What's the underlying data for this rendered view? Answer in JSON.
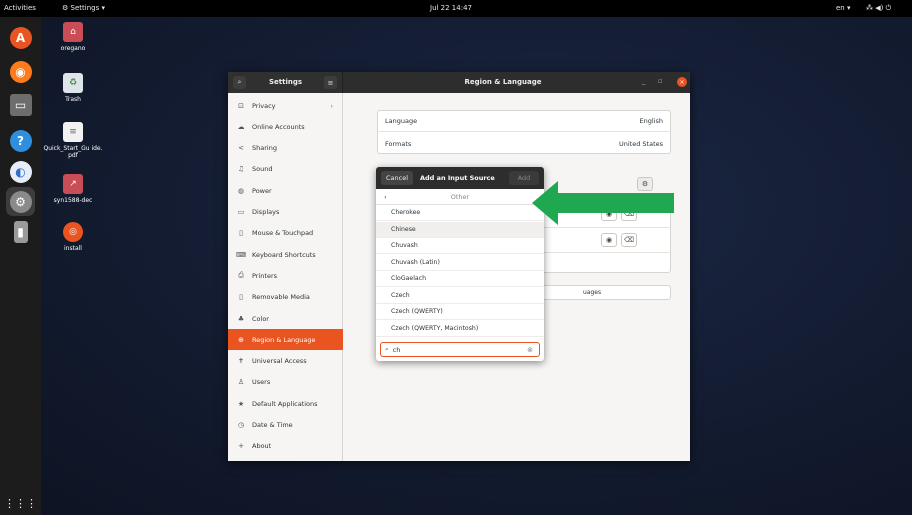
{
  "topbar": {
    "activities": "Activities",
    "app_menu": "Settings",
    "app_menu_caret": "▾",
    "clock": "Jul 22  14:47",
    "lang": "en",
    "lang_caret": "▾",
    "status_icons": "⁂ ◀) ⏻"
  },
  "dock": {
    "items": [
      {
        "name": "ubuntu-software",
        "glyph": "A"
      },
      {
        "name": "firefox",
        "glyph": "◉"
      },
      {
        "name": "files",
        "glyph": "▭"
      },
      {
        "name": "help",
        "glyph": "?"
      },
      {
        "name": "app",
        "glyph": "◐"
      },
      {
        "name": "settings",
        "glyph": "⚙"
      },
      {
        "name": "usb",
        "glyph": "▮"
      }
    ],
    "grid": "⋮⋮⋮"
  },
  "desktop_icons": [
    {
      "label": "oregano",
      "glyph": "⌂"
    },
    {
      "label": "Trash",
      "glyph": "♻"
    },
    {
      "label": "Quick_Start_Gu ide.pdf",
      "glyph": "≡"
    },
    {
      "label": "syn1588-dec",
      "glyph": "↗"
    },
    {
      "label": "install",
      "glyph": "◎"
    }
  ],
  "window": {
    "title_left": "Settings",
    "title_main": "Region & Language",
    "search_glyph": "⌕",
    "menu_glyph": "≡",
    "minimize": "_",
    "maximize": "▫",
    "close": "×"
  },
  "sidebar": {
    "items": [
      {
        "label": "Privacy",
        "icon": "⊡",
        "chevron": "›"
      },
      {
        "label": "Online Accounts",
        "icon": "☁"
      },
      {
        "label": "Sharing",
        "icon": "<"
      },
      {
        "label": "Sound",
        "icon": "♫"
      },
      {
        "label": "Power",
        "icon": "◍"
      },
      {
        "label": "Displays",
        "icon": "▭"
      },
      {
        "label": "Mouse & Touchpad",
        "icon": "▯"
      },
      {
        "label": "Keyboard Shortcuts",
        "icon": "⌨"
      },
      {
        "label": "Printers",
        "icon": "⎙"
      },
      {
        "label": "Removable Media",
        "icon": "▯"
      },
      {
        "label": "Color",
        "icon": "♣"
      },
      {
        "label": "Region & Language",
        "icon": "⊕",
        "selected": true
      },
      {
        "label": "Universal Access",
        "icon": "✝"
      },
      {
        "label": "Users",
        "icon": "♙"
      },
      {
        "label": "Default Applications",
        "icon": "★"
      },
      {
        "label": "Date & Time",
        "icon": "◷"
      },
      {
        "label": "About",
        "icon": "+"
      }
    ]
  },
  "main": {
    "language_label": "Language",
    "language_value": "English",
    "formats_label": "Formats",
    "formats_value": "United States",
    "gear_glyph": "⚙",
    "eye_glyph": "◉",
    "trash_glyph": "🗑",
    "manage_fragment": "uages"
  },
  "dialog": {
    "cancel": "Cancel",
    "title": "Add an Input Source",
    "add": "Add",
    "back_chevron": "‹",
    "back_label": "Other",
    "items": [
      {
        "label": "Cherokee"
      },
      {
        "label": "Chinese",
        "highlight": true
      },
      {
        "label": "Chuvash"
      },
      {
        "label": "Chuvash (Latin)"
      },
      {
        "label": "CloGaelach"
      },
      {
        "label": "Czech"
      },
      {
        "label": "Czech (QWERTY)"
      },
      {
        "label": "Czech (QWERTY, Macintosh)"
      }
    ],
    "search_icon": "⌕",
    "search_value": "ch",
    "search_clear": "⊗"
  },
  "colors": {
    "accent": "#e95420",
    "arrow": "#1fa84f"
  }
}
